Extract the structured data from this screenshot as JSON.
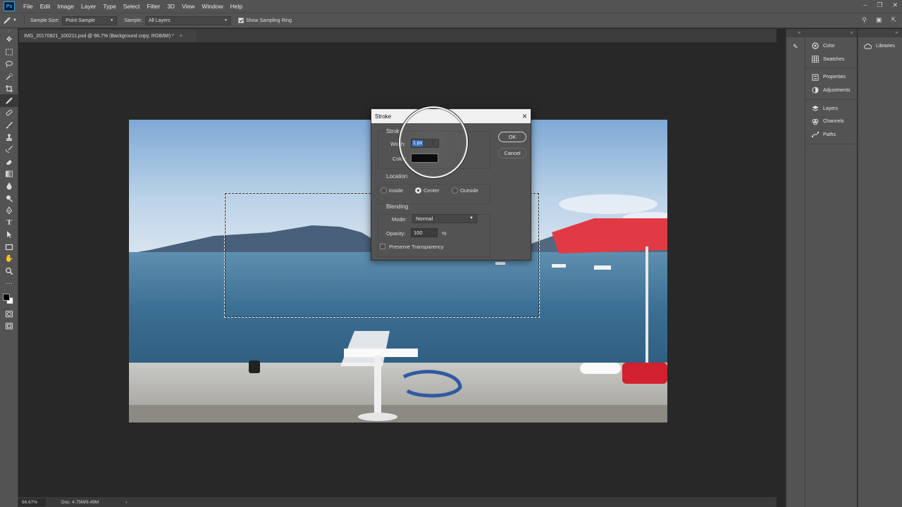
{
  "menubar": {
    "logo": "Ps",
    "items": [
      "File",
      "Edit",
      "Image",
      "Layer",
      "Type",
      "Select",
      "Filter",
      "3D",
      "View",
      "Window",
      "Help"
    ]
  },
  "options": {
    "sample_size_label": "Sample Size:",
    "sample_size_value": "Point Sample",
    "sample_label": "Sample:",
    "sample_value": "All Layers",
    "show_ring_label": "Show Sampling Ring"
  },
  "document": {
    "tab_title": "IMG_20170821_100211.psd @ 66.7% (Background copy, RGB/8#) *"
  },
  "status": {
    "zoom": "66.67%",
    "doc": "Doc: 4.75M/9.49M"
  },
  "panels": {
    "group1": [
      {
        "label": "Color",
        "icon": "color-wheel-icon"
      },
      {
        "label": "Swatches",
        "icon": "grid-icon"
      }
    ],
    "group2": [
      {
        "label": "Properties",
        "icon": "properties-icon"
      },
      {
        "label": "Adjustments",
        "icon": "adjust-icon"
      }
    ],
    "group3": [
      {
        "label": "Layers",
        "icon": "layers-icon"
      },
      {
        "label": "Channels",
        "icon": "channels-icon"
      },
      {
        "label": "Paths",
        "icon": "paths-icon"
      }
    ],
    "libraries": "Libraries"
  },
  "dialog": {
    "title": "Stroke",
    "stroke_group": "Stroke",
    "width_label": "Width:",
    "width_value": "1 px",
    "color_label": "Color:",
    "color_value": "#000000",
    "location_group": "Location",
    "location_options": [
      "Inside",
      "Center",
      "Outside"
    ],
    "location_selected": "Center",
    "blending_group": "Blending",
    "mode_label": "Mode:",
    "mode_value": "Normal",
    "opacity_label": "Opacity:",
    "opacity_value": "100",
    "opacity_unit": "%",
    "preserve_label": "Preserve Transparency",
    "ok": "OK",
    "cancel": "Cancel"
  }
}
